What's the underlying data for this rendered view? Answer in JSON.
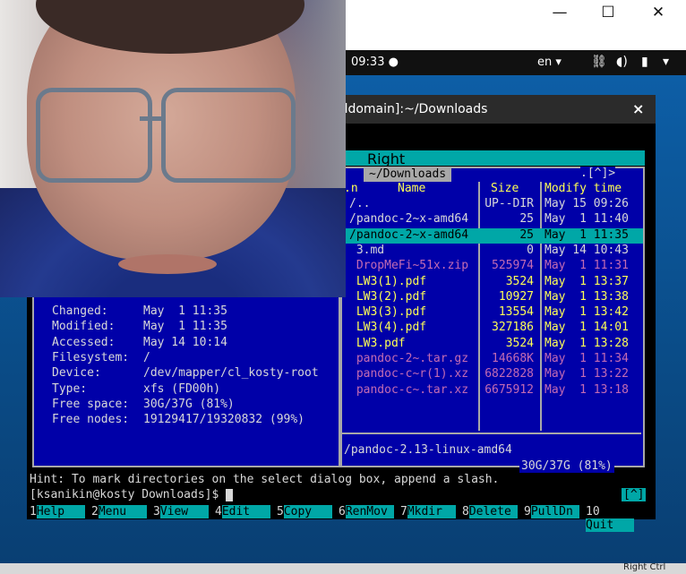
{
  "window": {
    "minimize": "—",
    "maximize": "☐",
    "close": "✕"
  },
  "topbar": {
    "clock": "09:33 ●",
    "lang": "en ▾",
    "network_icon": "network-icon",
    "battery_icon": "battery-icon"
  },
  "terminal": {
    "title": "aldomain]:~/Downloads",
    "close": "×"
  },
  "mc": {
    "menu_right": "Right",
    "right_path": "~/Downloads",
    "nav": ".[^]>",
    "columns": {
      "name_prefix": ".n",
      "name": "Name",
      "size": "Size",
      "modify": "Modify time"
    },
    "files": [
      {
        "name": "/..",
        "size": "UP--DIR",
        "time": "May 15 09:26",
        "color": "#d8d8d8"
      },
      {
        "name": "/pandoc-2~x-amd64",
        "size": "25",
        "time": "May  1 11:40",
        "color": "#d8d8d8"
      },
      {
        "name": "/pandoc-2~x-amd64",
        "size": "25",
        "time": "May  1 11:35",
        "color": "#000000"
      },
      {
        "name": " 3.md",
        "size": "0",
        "time": "May 14 10:43",
        "color": "#d8d8d8"
      },
      {
        "name": " DropMeFi~51x.zip",
        "size": "525974",
        "time": "May  1 11:31",
        "color": "#c36bb3"
      },
      {
        "name": " LW3(1).pdf",
        "size": "3524",
        "time": "May  1 13:37",
        "color": "#ffff55"
      },
      {
        "name": " LW3(2).pdf",
        "size": "10927",
        "time": "May  1 13:38",
        "color": "#ffff55"
      },
      {
        "name": " LW3(3).pdf",
        "size": "13554",
        "time": "May  1 13:42",
        "color": "#ffff55"
      },
      {
        "name": " LW3(4).pdf",
        "size": "327186",
        "time": "May  1 14:01",
        "color": "#ffff55"
      },
      {
        "name": " LW3.pdf",
        "size": "3524",
        "time": "May  1 13:28",
        "color": "#ffff55"
      },
      {
        "name": " pandoc-2~.tar.gz",
        "size": "14668K",
        "time": "May  1 11:34",
        "color": "#c36bb3"
      },
      {
        "name": " pandoc-c~r(1).xz",
        "size": "6822828",
        "time": "May  1 13:22",
        "color": "#c36bb3"
      },
      {
        "name": " pandoc-c~.tar.xz",
        "size": "6675912",
        "time": "May  1 13:18",
        "color": "#c36bb3"
      }
    ],
    "mini_status": "/pandoc-2.13-linux-amd64",
    "free_space": "30G/37G (81%)",
    "info": [
      {
        "k": "Changed:",
        "v": "May  1 11:35"
      },
      {
        "k": "Modified:",
        "v": "May  1 11:35"
      },
      {
        "k": "Accessed:",
        "v": "May 14 10:14"
      },
      {
        "k": "Filesystem:",
        "v": "/"
      },
      {
        "k": "Device:",
        "v": "/dev/mapper/cl_kosty-root"
      },
      {
        "k": "Type:",
        "v": "xfs (FD00h)"
      },
      {
        "k": "Free space:",
        "v": "30G/37G (81%)"
      },
      {
        "k": "Free nodes:",
        "v": "19129417/19320832 (99%)"
      }
    ],
    "hint": "Hint: To mark directories on the select dialog box, append a slash.",
    "prompt": "[ksanikin@kosty Downloads]$",
    "caret_badge": "[^]",
    "fkeys": [
      {
        "n": "1",
        "l": "Help"
      },
      {
        "n": "2",
        "l": "Menu"
      },
      {
        "n": "3",
        "l": "View"
      },
      {
        "n": "4",
        "l": "Edit"
      },
      {
        "n": "5",
        "l": "Copy"
      },
      {
        "n": "6",
        "l": "RenMov"
      },
      {
        "n": "7",
        "l": "Mkdir"
      },
      {
        "n": "8",
        "l": "Delete"
      },
      {
        "n": "9",
        "l": "PullDn"
      },
      {
        "n": "10",
        "l": "Quit"
      }
    ]
  },
  "taskbar": {
    "label": "Right Ctrl"
  }
}
